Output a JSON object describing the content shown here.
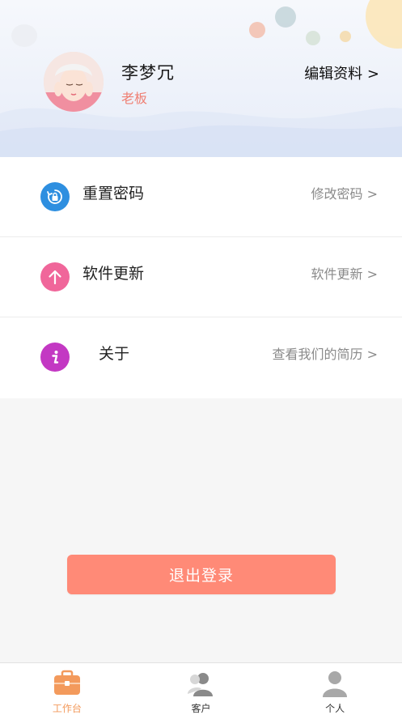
{
  "profile": {
    "name": "李梦冗",
    "role": "老板",
    "edit_label": "编辑资料 >"
  },
  "menu": {
    "items": [
      {
        "label": "重置密码",
        "action": "修改密码 >",
        "icon": "reset-lock-icon",
        "color": "#2e8fe0"
      },
      {
        "label": "软件更新",
        "action": "软件更新 >",
        "icon": "arrow-up-icon",
        "color": "#f0669a"
      },
      {
        "label": "关于",
        "action": "查看我们的简历 >",
        "icon": "info-icon",
        "color": "#c338c3"
      }
    ]
  },
  "logout_label": "退出登录",
  "tabbar": {
    "tabs": [
      {
        "label": "工作台",
        "icon": "briefcase-icon",
        "active": true
      },
      {
        "label": "客户",
        "icon": "customers-icon",
        "active": false
      },
      {
        "label": "个人",
        "icon": "person-icon",
        "active": false
      }
    ]
  },
  "colors": {
    "accent": "#ff8a77",
    "active_tab": "#f39a5c",
    "role": "#ef7f73"
  }
}
